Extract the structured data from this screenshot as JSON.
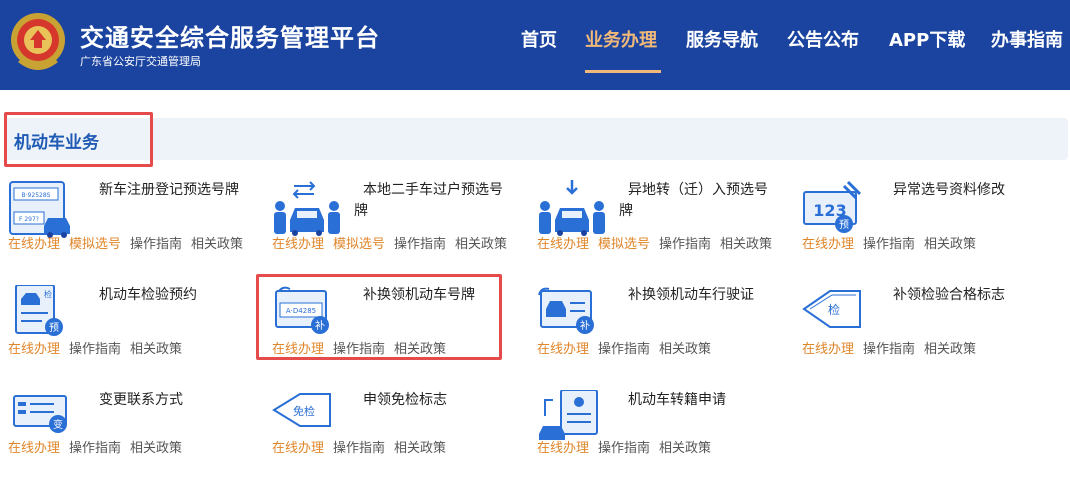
{
  "header": {
    "title": "交通安全综合服务管理平台",
    "subtitle": "广东省公安厅交通管理局",
    "nav": [
      "首页",
      "业务办理",
      "服务导航",
      "公告公布",
      "APP下载",
      "办事指南"
    ]
  },
  "section": {
    "title": "机动车业务"
  },
  "cards": [
    {
      "title": "新车注册登记预选号牌",
      "links": [
        "在线办理",
        "模拟选号",
        "操作指南",
        "相关政策"
      ]
    },
    {
      "title": "本地二手车过户预选号牌",
      "links": [
        "在线办理",
        "模拟选号",
        "操作指南",
        "相关政策"
      ]
    },
    {
      "title": "异地转（迁）入预选号牌",
      "links": [
        "在线办理",
        "模拟选号",
        "操作指南",
        "相关政策"
      ]
    },
    {
      "title": "异常选号资料修改",
      "links": [
        "在线办理",
        "操作指南",
        "相关政策"
      ]
    },
    {
      "title": "机动车检验预约",
      "links": [
        "在线办理",
        "操作指南",
        "相关政策"
      ]
    },
    {
      "title": "补换领机动车号牌",
      "links": [
        "在线办理",
        "操作指南",
        "相关政策"
      ]
    },
    {
      "title": "补换领机动车行驶证",
      "links": [
        "在线办理",
        "操作指南",
        "相关政策"
      ]
    },
    {
      "title": "补领检验合格标志",
      "links": [
        "在线办理",
        "操作指南",
        "相关政策"
      ]
    },
    {
      "title": "变更联系方式",
      "links": [
        "在线办理",
        "操作指南",
        "相关政策"
      ]
    },
    {
      "title": "申领免检标志",
      "links": [
        "在线办理",
        "操作指南",
        "相关政策"
      ]
    },
    {
      "title": "机动车转籍申请",
      "links": [
        "在线办理",
        "操作指南",
        "相关政策"
      ]
    }
  ],
  "icon_text": {
    "plate_top": "B·92528S",
    "plate_bottom": "F 297?",
    "num": "123",
    "yu": "预",
    "jian": "检",
    "bu": "补",
    "plate_mid": "A·D4285",
    "bian": "变",
    "mianjian": "免检"
  },
  "colors": {
    "header_bg": "#1b44a0",
    "nav_active": "#f0b97a",
    "online": "#e0862a",
    "highlight": "#e54b4b",
    "icon_blue": "#2a6fd6"
  }
}
